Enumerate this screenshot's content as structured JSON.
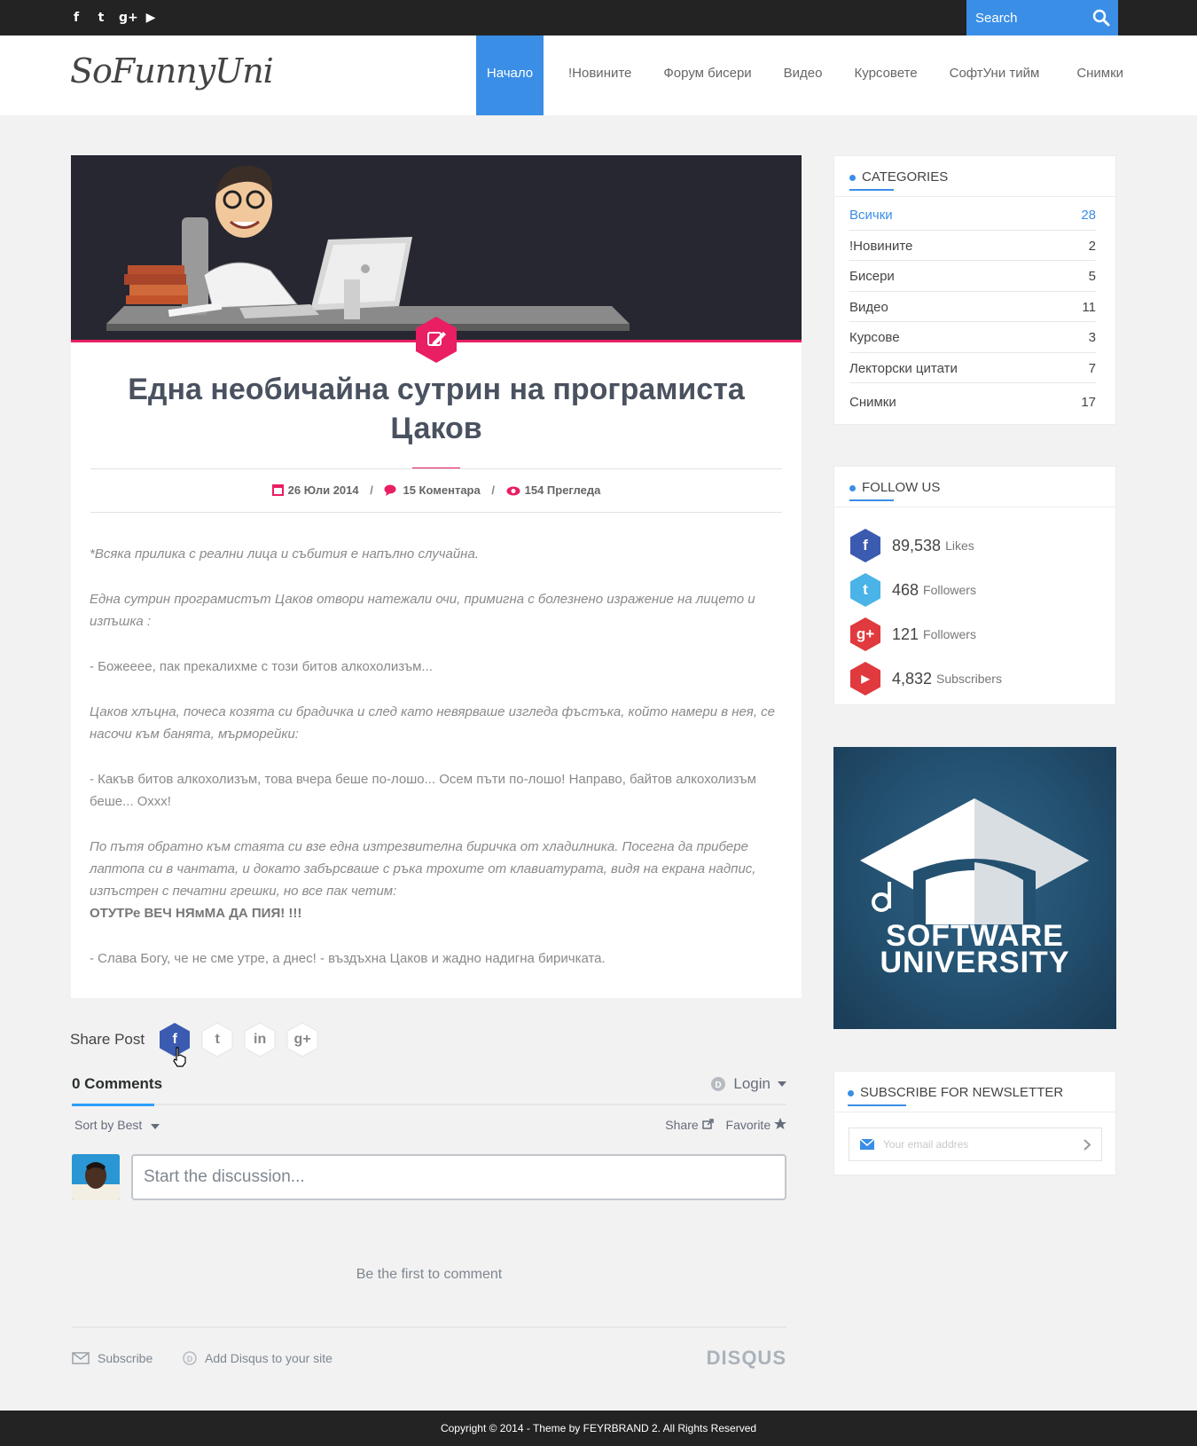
{
  "topbar": {
    "social": [
      {
        "icon": "facebook-icon",
        "glyph": "f"
      },
      {
        "icon": "twitter-icon",
        "glyph": "t"
      },
      {
        "icon": "google-plus-icon",
        "glyph": "g+"
      },
      {
        "icon": "youtube-icon",
        "glyph": "▶"
      }
    ],
    "search_placeholder": "Search"
  },
  "header": {
    "logo": "SoFunnyUni",
    "nav": [
      "Начало",
      "!Новините",
      "Форум бисери",
      "Видео",
      "Курсовете",
      "СофтУни тийм",
      "Снимки"
    ]
  },
  "post": {
    "title": "Една необичайна сутрин на програмиста Цаков",
    "date": "26 Юли 2014",
    "comments": "15 Коментара",
    "views": "154 Прегледа",
    "p1": "*Всяка прилика с реални лица и събития е напълно случайна.",
    "p2": "Една сутрин програмистът Цаков отвори натежали очи, примигна с болезнено изражение на лицето и изпъшка :",
    "p3": "- Божееее, пак прекалихме  с този битов алкохолизъм...",
    "p4": "Цаков хлъцна, почеса козята си брадичка и след като невярваше изгледа фъстъка, който намери в нея, се насочи към банята, мърморейки:",
    "p5": "- Какъв битов алкохолизъм, това вчера беше по-лошо... Осем пъти по-лошо! Направо, байтов алкохолизъм беше... Охxx!",
    "p6": "По пътя обратно към стаята си взе една изтрезвителна биричка от хладилника. Посегна да прибере лаптопа си в чантата, и докато забърсваше с ръка трохите от клавиатурата, видя на екрана надпис, изпъстрен с печатни грешки, но все пак четим:",
    "p6b": "ОТУТРе ВЕЧ НЯмМА ДА ПИЯ!   !!!",
    "p7": "- Слава Богу, че не сме утре, а днес!  - въздъхна Цаков и жадно надигна биричката."
  },
  "share": {
    "label": "Share Post",
    "buttons": [
      {
        "icon": "facebook-icon",
        "glyph": "f",
        "color": "#3b5bb0"
      },
      {
        "icon": "twitter-icon",
        "glyph": "t",
        "color": "#ffffff"
      },
      {
        "icon": "linkedin-icon",
        "glyph": "in",
        "color": "#ffffff"
      },
      {
        "icon": "google-plus-icon",
        "glyph": "g+",
        "color": "#ffffff"
      }
    ]
  },
  "disqus": {
    "comments_tab": "0 Comments",
    "login": "Login",
    "sort": "Sort by Best",
    "share": "Share",
    "favorite": "Favorite",
    "placeholder": "Start the discussion...",
    "first": "Be the first to comment",
    "subscribe": "Subscribe",
    "add": "Add Disqus to your site",
    "logo": "DISQUS"
  },
  "categories": {
    "title": "CATEGORIES",
    "items": [
      {
        "name": "Всички",
        "count": "28"
      },
      {
        "name": "!Новините",
        "count": "2"
      },
      {
        "name": "Бисери",
        "count": "5"
      },
      {
        "name": "Видео",
        "count": "11"
      },
      {
        "name": "Курсове",
        "count": "3"
      },
      {
        "name": "Лекторски цитати",
        "count": "7"
      },
      {
        "name": "Снимки",
        "count": "17"
      }
    ]
  },
  "follow": {
    "title": "FOLLOW US",
    "items": [
      {
        "icon": "facebook-icon",
        "glyph": "f",
        "color": "#3b5bb0",
        "num": "89,538",
        "label": "Likes"
      },
      {
        "icon": "twitter-icon",
        "glyph": "t",
        "color": "#4ab3e8",
        "num": "468",
        "label": "Followers"
      },
      {
        "icon": "google-plus-icon",
        "glyph": "g+",
        "color": "#e0393e",
        "num": "121",
        "label": "Followers"
      },
      {
        "icon": "youtube-icon",
        "glyph": "▶",
        "color": "#e0393e",
        "num": "4,832",
        "label": "Subscribers"
      }
    ]
  },
  "banner": {
    "line1": "SOFTWARE",
    "line2": "UNIVERSITY"
  },
  "newsletter": {
    "title": "SUBSCRIBE FOR NEWSLETTER",
    "placeholder": "Your email addres"
  },
  "footer": {
    "text": "Copyright © 2014 - Theme by FEYRBRAND 2. All Rights Reserved"
  },
  "colors": {
    "accent": "#3a8ee6",
    "pink": "#e91e63",
    "dark": "#232323"
  }
}
